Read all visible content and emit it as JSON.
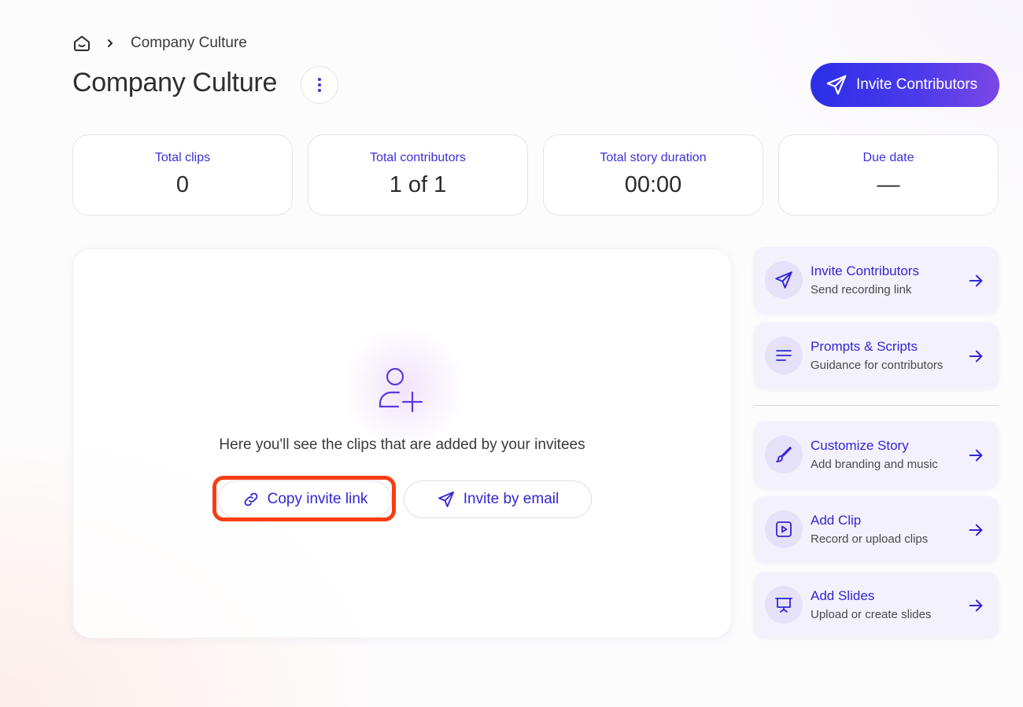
{
  "breadcrumb": {
    "home_icon": "home-icon",
    "current": "Company Culture"
  },
  "header": {
    "title": "Company Culture",
    "more_icon": "more-vertical-icon",
    "invite_cta": "Invite Contributors"
  },
  "stats": [
    {
      "label": "Total clips",
      "value": "0"
    },
    {
      "label": "Total contributors",
      "value": "1 of 1"
    },
    {
      "label": "Total story duration",
      "value": "00:00"
    },
    {
      "label": "Due date",
      "value": "—"
    }
  ],
  "empty_state": {
    "icon": "add-person-icon",
    "message": "Here you'll see the clips that are added by your invitees",
    "copy_link": "Copy invite link",
    "invite_email": "Invite by email"
  },
  "actions": [
    {
      "title": "Invite Contributors",
      "subtitle": "Send recording link",
      "icon": "send-icon"
    },
    {
      "title": "Prompts & Scripts",
      "subtitle": "Guidance for contributors",
      "icon": "lines-icon"
    },
    {
      "title": "Customize Story",
      "subtitle": "Add branding and music",
      "icon": "brush-icon"
    },
    {
      "title": "Add Clip",
      "subtitle": "Record or upload clips",
      "icon": "play-square-icon"
    },
    {
      "title": "Add Slides",
      "subtitle": "Upload or create slides",
      "icon": "presentation-icon"
    }
  ],
  "colors": {
    "accent": "#3326d6",
    "cta_gradient_start": "#2b2ee8",
    "cta_gradient_end": "#7b47e6",
    "highlight": "#f73d12",
    "action_bg": "#f3f1fc"
  }
}
